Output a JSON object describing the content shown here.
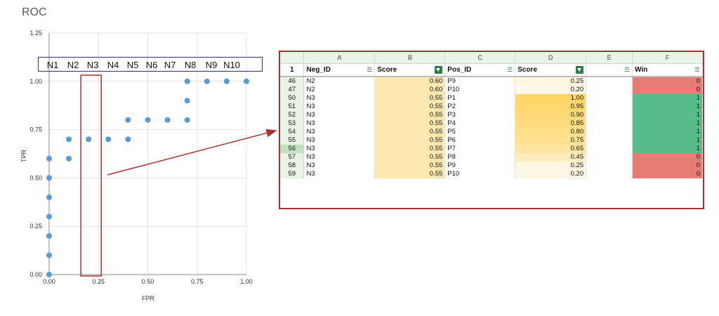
{
  "chart_data": {
    "type": "scatter",
    "title": "ROC",
    "xlabel": "FPR",
    "ylabel": "TPR",
    "xlim": [
      0,
      1
    ],
    "ylim": [
      0,
      1.25
    ],
    "xticks": [
      "0.00",
      "0.25",
      "0.50",
      "0.75",
      "1.00"
    ],
    "yticks": [
      "0.00",
      "0.25",
      "0.50",
      "0.75",
      "1.00",
      "1.25"
    ],
    "grid": true,
    "point_color": "#5b9bd5",
    "points": [
      {
        "x": 0,
        "y": 0
      },
      {
        "x": 0,
        "y": 0.1
      },
      {
        "x": 0,
        "y": 0.2
      },
      {
        "x": 0,
        "y": 0.3
      },
      {
        "x": 0,
        "y": 0.4
      },
      {
        "x": 0,
        "y": 0.5
      },
      {
        "x": 0,
        "y": 0.6
      },
      {
        "x": 0.1,
        "y": 0.6
      },
      {
        "x": 0.1,
        "y": 0.7
      },
      {
        "x": 0.2,
        "y": 0.7
      },
      {
        "x": 0.3,
        "y": 0.7
      },
      {
        "x": 0.4,
        "y": 0.7
      },
      {
        "x": 0.4,
        "y": 0.8
      },
      {
        "x": 0.5,
        "y": 0.8
      },
      {
        "x": 0.6,
        "y": 0.8
      },
      {
        "x": 0.7,
        "y": 0.8
      },
      {
        "x": 0.7,
        "y": 0.9
      },
      {
        "x": 0.7,
        "y": 1.0
      },
      {
        "x": 0.8,
        "y": 1.0
      },
      {
        "x": 0.9,
        "y": 1.0
      },
      {
        "x": 1.0,
        "y": 1.0
      }
    ],
    "annotations": {
      "negative_labels": [
        "N1",
        "N2",
        "N3",
        "N4",
        "N5",
        "N6",
        "N7",
        "N8",
        "N9",
        "N10"
      ],
      "highlight_x_range": [
        0.2,
        0.3
      ]
    }
  },
  "spreadsheet": {
    "column_letters": [
      "A",
      "B",
      "C",
      "D",
      "E",
      "F"
    ],
    "header_row_num": "1",
    "headers": [
      "Neg_ID",
      "Score",
      "Pos_ID",
      "Score",
      "",
      "Win"
    ],
    "rows": [
      {
        "num": "46",
        "neg_id": "N2",
        "neg_score": "0.60",
        "pos_id": "P9",
        "pos_score": "0.25",
        "win": "0"
      },
      {
        "num": "47",
        "neg_id": "N2",
        "neg_score": "0.60",
        "pos_id": "P10",
        "pos_score": "0.20",
        "win": "0"
      },
      {
        "num": "50",
        "neg_id": "N3",
        "neg_score": "0.55",
        "pos_id": "P1",
        "pos_score": "1.00",
        "win": "1"
      },
      {
        "num": "51",
        "neg_id": "N3",
        "neg_score": "0.55",
        "pos_id": "P2",
        "pos_score": "0.95",
        "win": "1"
      },
      {
        "num": "52",
        "neg_id": "N3",
        "neg_score": "0.55",
        "pos_id": "P3",
        "pos_score": "0.90",
        "win": "1"
      },
      {
        "num": "53",
        "neg_id": "N3",
        "neg_score": "0.55",
        "pos_id": "P4",
        "pos_score": "0.85",
        "win": "1"
      },
      {
        "num": "54",
        "neg_id": "N3",
        "neg_score": "0.55",
        "pos_id": "P5",
        "pos_score": "0.80",
        "win": "1"
      },
      {
        "num": "55",
        "neg_id": "N3",
        "neg_score": "0.55",
        "pos_id": "P6",
        "pos_score": "0.75",
        "win": "1"
      },
      {
        "num": "56",
        "neg_id": "N3",
        "neg_score": "0.55",
        "pos_id": "P7",
        "pos_score": "0.65",
        "win": "1"
      },
      {
        "num": "57",
        "neg_id": "N3",
        "neg_score": "0.55",
        "pos_id": "P8",
        "pos_score": "0.45",
        "win": "0"
      },
      {
        "num": "58",
        "neg_id": "N3",
        "neg_score": "0.55",
        "pos_id": "P9",
        "pos_score": "0.25",
        "win": "0"
      },
      {
        "num": "59",
        "neg_id": "N3",
        "neg_score": "0.55",
        "pos_id": "P10",
        "pos_score": "0.20",
        "win": "0"
      }
    ],
    "selected_row": "56",
    "colors": {
      "win_true": "#57bb8a",
      "win_false": "#e67c73",
      "neg_score_fill": "#fde9b0",
      "pos_score_high": "#ffd666",
      "pos_score_low": "#fff8e8",
      "callout": "#a8322d"
    }
  }
}
